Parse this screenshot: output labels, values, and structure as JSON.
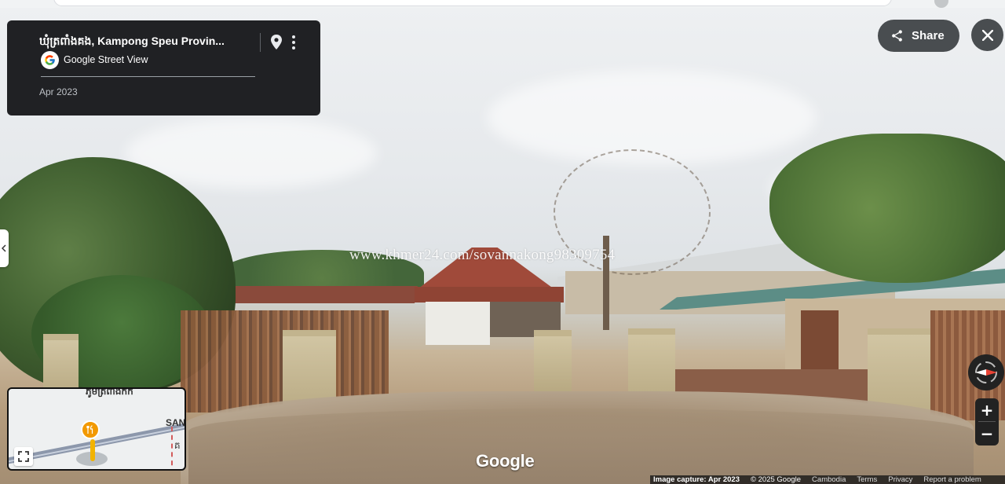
{
  "info_card": {
    "title": "ឃុំត្រពាំងគង, Kampong Speu Provin...",
    "service_label": "Google Street View",
    "capture_date": "Apr 2023"
  },
  "actions": {
    "share_label": "Share"
  },
  "image": {
    "watermark": "www.khmer24.com/sovannakong98309754",
    "google_watermark": "Google"
  },
  "minimap": {
    "label_top": "ភូមិត្រពាំងកក់",
    "label_road": "SAN",
    "label_side": "គ"
  },
  "footer": {
    "capture": "Image capture: Apr 2023",
    "copyright": "© 2025 Google",
    "country": "Cambodia",
    "terms": "Terms",
    "privacy": "Privacy",
    "report": "Report a problem"
  },
  "colors": {
    "card_bg": "#202124",
    "button_bg": "#3c4043",
    "marker": "#f29900",
    "compass_needle": "#ea4335"
  },
  "icons": [
    "pin-icon",
    "more-vert-icon",
    "google-g-icon",
    "share-icon",
    "close-icon",
    "chevron-left-icon",
    "compass-icon",
    "fullscreen-icon",
    "restaurant-icon"
  ]
}
